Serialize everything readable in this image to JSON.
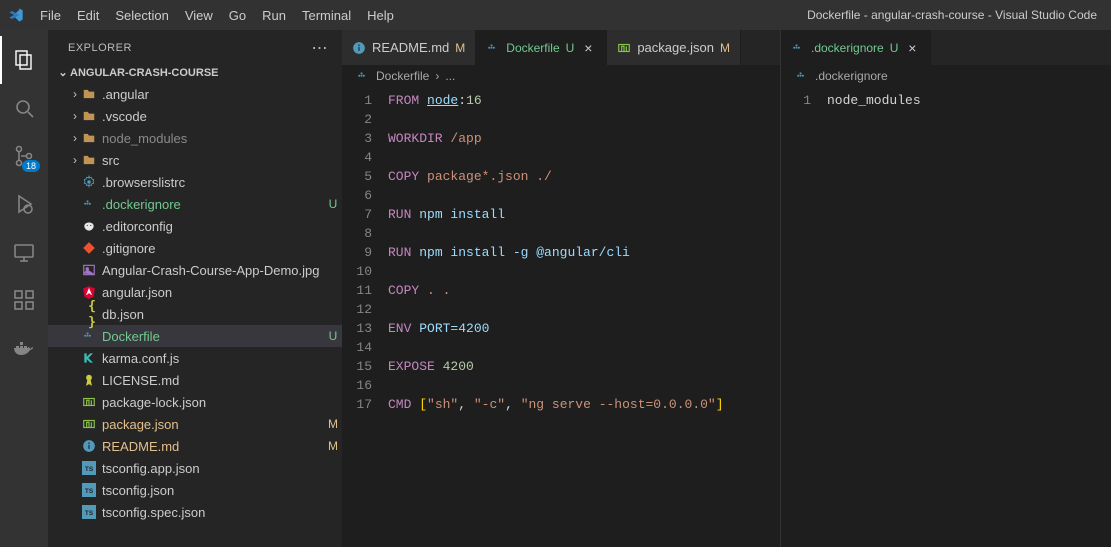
{
  "window_title": "Dockerfile - angular-crash-course - Visual Studio Code",
  "menu": [
    "File",
    "Edit",
    "Selection",
    "View",
    "Go",
    "Run",
    "Terminal",
    "Help"
  ],
  "activity_bar": {
    "items": [
      {
        "name": "explorer-icon",
        "active": true
      },
      {
        "name": "search-icon",
        "active": false
      },
      {
        "name": "source-control-icon",
        "active": false,
        "badge": "18"
      },
      {
        "name": "run-debug-icon",
        "active": false
      },
      {
        "name": "remote-icon",
        "active": false
      },
      {
        "name": "extensions-icon",
        "active": false
      },
      {
        "name": "docker-icon",
        "active": false
      }
    ]
  },
  "sidebar": {
    "title": "EXPLORER",
    "section_label": "ANGULAR-CRASH-COURSE",
    "entries": [
      {
        "type": "folder",
        "label": ".angular",
        "expandable": true
      },
      {
        "type": "folder",
        "label": ".vscode",
        "expandable": true
      },
      {
        "type": "folder",
        "label": "node_modules",
        "expandable": true,
        "dim": true
      },
      {
        "type": "folder",
        "label": "src",
        "expandable": true
      },
      {
        "type": "file",
        "label": ".browserslistrc",
        "icon": "gear",
        "color": "#519aba"
      },
      {
        "type": "file",
        "label": ".dockerignore",
        "icon": "docker",
        "color": "#519aba",
        "status": "U",
        "state": "untracked"
      },
      {
        "type": "file",
        "label": ".editorconfig",
        "icon": "editorconfig",
        "color": "#e8e8e8"
      },
      {
        "type": "file",
        "label": ".gitignore",
        "icon": "git",
        "color": "#f1502f"
      },
      {
        "type": "file",
        "label": "Angular-Crash-Course-App-Demo.jpg",
        "icon": "image",
        "color": "#a074c4"
      },
      {
        "type": "file",
        "label": "angular.json",
        "icon": "angular",
        "color": "#dd0031"
      },
      {
        "type": "file",
        "label": "db.json",
        "icon": "json",
        "color": "#cbcb41"
      },
      {
        "type": "file",
        "label": "Dockerfile",
        "icon": "docker",
        "color": "#519aba",
        "status": "U",
        "state": "untracked",
        "active": true
      },
      {
        "type": "file",
        "label": "karma.conf.js",
        "icon": "karma",
        "color": "#3cbeb1"
      },
      {
        "type": "file",
        "label": "LICENSE.md",
        "icon": "license",
        "color": "#cbcb41"
      },
      {
        "type": "file",
        "label": "package-lock.json",
        "icon": "npm",
        "color": "#8bc34a"
      },
      {
        "type": "file",
        "label": "package.json",
        "icon": "npm",
        "color": "#8bc34a",
        "status": "M",
        "state": "modified"
      },
      {
        "type": "file",
        "label": "README.md",
        "icon": "info",
        "color": "#519aba",
        "status": "M",
        "state": "modified"
      },
      {
        "type": "file",
        "label": "tsconfig.app.json",
        "icon": "ts",
        "color": "#519aba"
      },
      {
        "type": "file",
        "label": "tsconfig.json",
        "icon": "ts",
        "color": "#519aba"
      },
      {
        "type": "file",
        "label": "tsconfig.spec.json",
        "icon": "ts",
        "color": "#519aba"
      }
    ]
  },
  "editor_groups": {
    "left": {
      "tabs": [
        {
          "icon": "info",
          "color": "#519aba",
          "label": "README.md",
          "status": "M",
          "state": "modified",
          "active": false
        },
        {
          "icon": "docker",
          "color": "#519aba",
          "label": "Dockerfile",
          "status": "U",
          "state": "untracked",
          "active": true,
          "closeable": true
        },
        {
          "icon": "npm",
          "color": "#8bc34a",
          "label": "package.json",
          "status": "M",
          "state": "modified",
          "active": false
        }
      ],
      "breadcrumb": [
        "Dockerfile",
        "..."
      ],
      "code_lines": [
        [
          [
            "kw",
            "FROM"
          ],
          [
            "plain",
            " "
          ],
          [
            "id",
            "node"
          ],
          [
            "plain",
            ":"
          ],
          [
            "num",
            "16"
          ]
        ],
        [],
        [
          [
            "kw",
            "WORKDIR"
          ],
          [
            "plain",
            " "
          ],
          [
            "path",
            "/app"
          ]
        ],
        [],
        [
          [
            "kw",
            "COPY"
          ],
          [
            "plain",
            " "
          ],
          [
            "str",
            "package*.json ./"
          ]
        ],
        [],
        [
          [
            "kw",
            "RUN"
          ],
          [
            "plain",
            " "
          ],
          [
            "cmd",
            "npm install"
          ]
        ],
        [],
        [
          [
            "kw",
            "RUN"
          ],
          [
            "plain",
            " "
          ],
          [
            "cmd",
            "npm install -g @angular/cli"
          ]
        ],
        [],
        [
          [
            "kw",
            "COPY"
          ],
          [
            "plain",
            " "
          ],
          [
            "str",
            ". ."
          ]
        ],
        [],
        [
          [
            "kw",
            "ENV"
          ],
          [
            "plain",
            " "
          ],
          [
            "cmd",
            "PORT=4200"
          ]
        ],
        [],
        [
          [
            "kw",
            "EXPOSE"
          ],
          [
            "plain",
            " "
          ],
          [
            "num",
            "4200"
          ]
        ],
        [],
        [
          [
            "kw",
            "CMD"
          ],
          [
            "plain",
            " "
          ],
          [
            "br",
            "["
          ],
          [
            "arg",
            "\"sh\""
          ],
          [
            "plain",
            ", "
          ],
          [
            "arg",
            "\"-c\""
          ],
          [
            "plain",
            ", "
          ],
          [
            "arg",
            "\"ng serve --host=0.0.0.0\""
          ],
          [
            "br",
            "]"
          ]
        ]
      ]
    },
    "right": {
      "tabs": [
        {
          "icon": "docker",
          "color": "#519aba",
          "label": ".dockerignore",
          "status": "U",
          "state": "untracked",
          "active": true,
          "closeable": true
        }
      ],
      "breadcrumb": [
        ".dockerignore"
      ],
      "code_lines": [
        [
          [
            "plain",
            "node_modules"
          ]
        ]
      ]
    }
  }
}
